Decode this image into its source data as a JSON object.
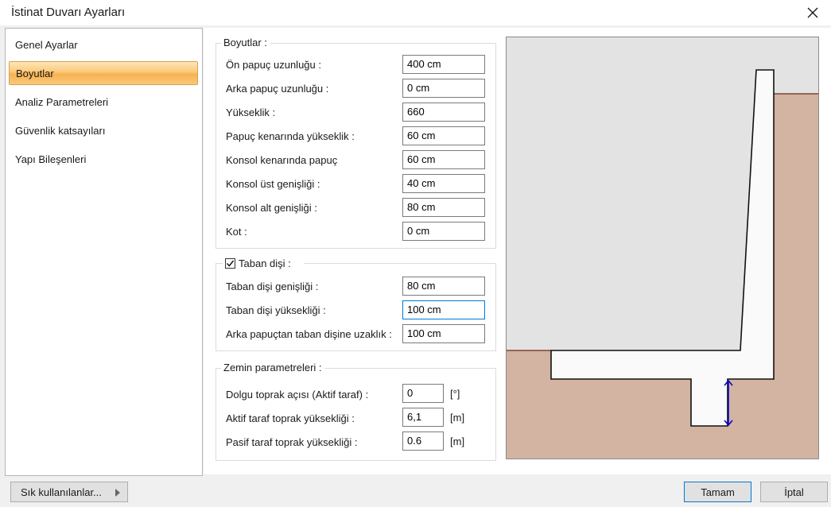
{
  "window": {
    "title": "İstinat Duvarı Ayarları"
  },
  "sidebar": {
    "items": [
      {
        "label": "Genel Ayarlar"
      },
      {
        "label": "Boyutlar"
      },
      {
        "label": "Analiz Parametreleri"
      },
      {
        "label": "Güvenlik katsayıları"
      },
      {
        "label": "Yapı Bileşenleri"
      }
    ],
    "selected": "Boyutlar"
  },
  "boyutlar": {
    "legend": "Boyutlar :",
    "rows": [
      {
        "label": "Ön papuç uzunluğu :",
        "value": "400 cm"
      },
      {
        "label": "Arka papuç uzunluğu :",
        "value": "0 cm"
      },
      {
        "label": "Yükseklik :",
        "value": "660"
      },
      {
        "label": "Papuç kenarında yükseklik :",
        "value": "60 cm"
      },
      {
        "label": "Konsol kenarında papuç",
        "value": "60 cm"
      },
      {
        "label": "Konsol üst genişliği :",
        "value": "40 cm"
      },
      {
        "label": "Konsol alt genişliği :",
        "value": "80 cm"
      },
      {
        "label": "Kot :",
        "value": "0 cm"
      }
    ]
  },
  "taban": {
    "legend": "Taban dişi :",
    "checked": true,
    "rows": [
      {
        "label": "Taban dişi genişliği :",
        "value": "80 cm"
      },
      {
        "label": "Taban dişi yüksekliği :",
        "value": "100 cm"
      },
      {
        "label": "Arka papuçtan taban dişine uzaklık :",
        "value": "100 cm"
      }
    ]
  },
  "zemin": {
    "legend": "Zemin parametreleri :",
    "rows": [
      {
        "label": "Dolgu toprak açısı (Aktif taraf) :",
        "value": "0",
        "unit": "[°]"
      },
      {
        "label": "Aktif taraf toprak yüksekliği :",
        "value": "6,1",
        "unit": "[m]"
      },
      {
        "label": "Pasif taraf toprak yüksekliği :",
        "value": "0.6",
        "unit": "[m]"
      }
    ]
  },
  "footer": {
    "favorites": "Sık kullanılanlar...",
    "ok": "Tamam",
    "cancel": "İptal"
  },
  "colors": {
    "soil": "#d3b3a1",
    "sky": "#e3e3e3",
    "wall": "#fafafa",
    "dimension": "#0000cc",
    "active_item": "#f9c46a"
  }
}
